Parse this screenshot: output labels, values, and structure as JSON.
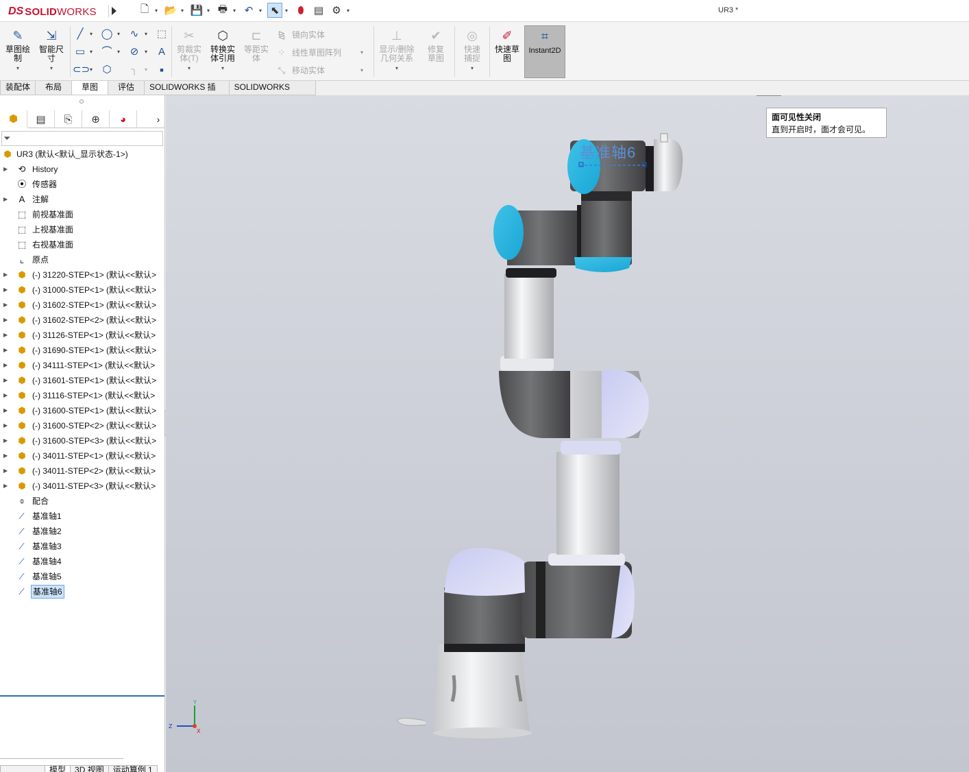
{
  "app": {
    "brand_prefix": "DS",
    "brand_main": "SOLID",
    "brand_suffix": "WORKS",
    "doc_title": "UR3 *"
  },
  "ribbon": {
    "sketch": "草图绘制",
    "smart_dim": "智能尺寸",
    "trim": "剪裁实体(T)",
    "convert": "转换实体引用",
    "offset": "等距实体",
    "mirror": "镜向实体",
    "linear_pattern": "线性草图阵列",
    "move": "移动实体",
    "show_delete": "显示/删除几何关系",
    "repair": "修复草图",
    "quick_snap": "快速捕捉",
    "rapid_sketch": "快速草图",
    "instant2d": "Instant2D"
  },
  "tabs": [
    "装配体",
    "布局",
    "草图",
    "评估",
    "SOLIDWORKS 插件",
    "SOLIDWORKS MBD"
  ],
  "tree": {
    "root": "UR3  (默认<默认_显示状态-1>)",
    "items": [
      {
        "label": "History",
        "icon": "history-icon",
        "exp": true
      },
      {
        "label": "传感器",
        "icon": "sensor-icon",
        "exp": false
      },
      {
        "label": "注解",
        "icon": "annotation-icon",
        "exp": true
      },
      {
        "label": "前视基准面",
        "icon": "plane-icon",
        "exp": false
      },
      {
        "label": "上视基准面",
        "icon": "plane-icon",
        "exp": false
      },
      {
        "label": "右视基准面",
        "icon": "plane-icon",
        "exp": false
      },
      {
        "label": "原点",
        "icon": "origin-icon",
        "exp": false
      },
      {
        "label": "(-) 31220-STEP<1> (默认<<默认>",
        "icon": "part-icon",
        "exp": true
      },
      {
        "label": "(-) 31000-STEP<1> (默认<<默认>",
        "icon": "part-icon",
        "exp": true
      },
      {
        "label": "(-) 31602-STEP<1> (默认<<默认>",
        "icon": "part-icon",
        "exp": true
      },
      {
        "label": "(-) 31602-STEP<2> (默认<<默认>",
        "icon": "part-icon",
        "exp": true
      },
      {
        "label": "(-) 31126-STEP<1> (默认<<默认>",
        "icon": "part-icon",
        "exp": true
      },
      {
        "label": "(-) 31690-STEP<1> (默认<<默认>",
        "icon": "part-icon",
        "exp": true
      },
      {
        "label": "(-) 34111-STEP<1> (默认<<默认>",
        "icon": "part-icon",
        "exp": true
      },
      {
        "label": "(-) 31601-STEP<1> (默认<<默认>",
        "icon": "part-icon",
        "exp": true
      },
      {
        "label": "(-) 31116-STEP<1> (默认<<默认>",
        "icon": "part-icon",
        "exp": true
      },
      {
        "label": "(-) 31600-STEP<1> (默认<<默认>",
        "icon": "part-icon",
        "exp": true
      },
      {
        "label": "(-) 31600-STEP<2> (默认<<默认>",
        "icon": "part-icon",
        "exp": true
      },
      {
        "label": "(-) 31600-STEP<3> (默认<<默认>",
        "icon": "part-icon",
        "exp": true
      },
      {
        "label": "(-) 34011-STEP<1> (默认<<默认>",
        "icon": "part-icon",
        "exp": true
      },
      {
        "label": "(-) 34011-STEP<2> (默认<<默认>",
        "icon": "part-icon",
        "exp": true
      },
      {
        "label": "(-) 34011-STEP<3> (默认<<默认>",
        "icon": "part-icon",
        "exp": true
      },
      {
        "label": "配合",
        "icon": "mate-icon",
        "exp": false
      },
      {
        "label": "基准轴1",
        "icon": "axis-icon",
        "exp": false
      },
      {
        "label": "基准轴2",
        "icon": "axis-icon",
        "exp": false
      },
      {
        "label": "基准轴3",
        "icon": "axis-icon",
        "exp": false
      },
      {
        "label": "基准轴4",
        "icon": "axis-icon",
        "exp": false
      },
      {
        "label": "基准轴5",
        "icon": "axis-icon",
        "exp": false
      },
      {
        "label": "基准轴6",
        "icon": "axis-icon",
        "exp": false,
        "selected": true
      }
    ]
  },
  "tooltip": {
    "title": "面可见性关闭",
    "body": "直到开启时，面才会可见。"
  },
  "viewport": {
    "axis_label": "基准轴6",
    "triad_x": "X",
    "triad_y": "Y",
    "triad_z": "Z"
  },
  "bottom_tabs": [
    "模型",
    "3D 视图",
    "运动算例 1"
  ]
}
